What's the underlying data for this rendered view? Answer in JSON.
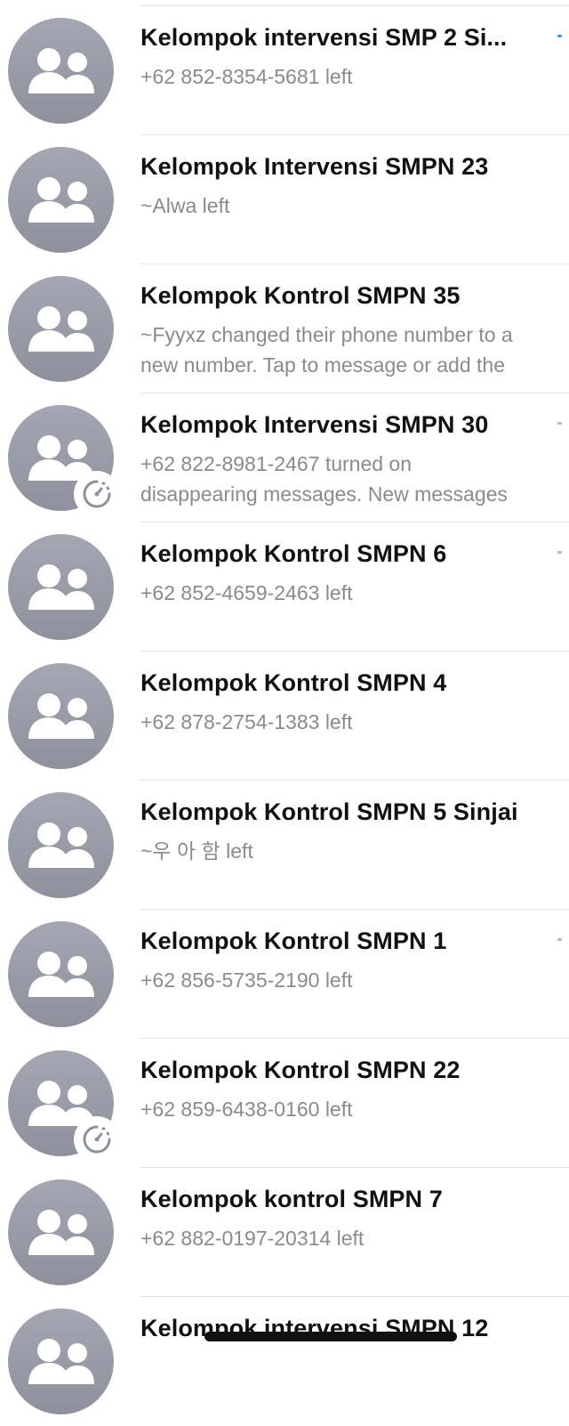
{
  "chats": [
    {
      "title": "Kelompok intervensi SMP 2 Si...",
      "subtitle": "+62 852-8354-5681 left",
      "avatar_icon": "group-icon",
      "disappearing": false,
      "unread_mark_color": "#4a8ff0"
    },
    {
      "title": "Kelompok Intervensi SMPN 23",
      "subtitle": "~Alwa left",
      "avatar_icon": "group-icon",
      "disappearing": false
    },
    {
      "title": "Kelompok Kontrol SMPN 35",
      "subtitle": "~Fyyxz changed their phone number to a\nnew number. Tap to message or add the",
      "avatar_icon": "group-icon",
      "disappearing": false
    },
    {
      "title": "Kelompok Intervensi SMPN 30",
      "subtitle": "+62 822-8981-2467 turned on\ndisappearing messages. New messages",
      "avatar_icon": "group-icon",
      "disappearing": true,
      "unread_mark_color": "#b9b9be"
    },
    {
      "title": "Kelompok Kontrol SMPN 6",
      "subtitle": "+62 852-4659-2463 left",
      "avatar_icon": "group-icon",
      "disappearing": false,
      "unread_mark_color": "#b9b9be"
    },
    {
      "title": "Kelompok Kontrol SMPN 4",
      "subtitle": "+62 878-2754-1383 left",
      "avatar_icon": "group-icon",
      "disappearing": false
    },
    {
      "title": "Kelompok Kontrol SMPN 5 Sinjai",
      "subtitle": "~우 아 함 left",
      "avatar_icon": "group-icon",
      "disappearing": false
    },
    {
      "title": "Kelompok Kontrol SMPN 1",
      "subtitle": "+62 856-5735-2190 left",
      "avatar_icon": "group-icon",
      "disappearing": false,
      "unread_mark_color": "#b9b9be"
    },
    {
      "title": "Kelompok Kontrol SMPN 22",
      "subtitle": "+62 859-6438-0160 left",
      "avatar_icon": "group-icon",
      "disappearing": true
    },
    {
      "title": "Kelompok kontrol SMPN 7",
      "subtitle": "+62 882-0197-20314 left",
      "avatar_icon": "group-icon",
      "disappearing": false
    },
    {
      "title": "Kelompok intervensi SMPN 12",
      "subtitle": "",
      "avatar_icon": "group-icon",
      "disappearing": false
    }
  ],
  "colors": {
    "avatar_background": "#9a9da7",
    "title_text": "#111111",
    "subtitle_text": "#8a8a8f",
    "divider": "#e3e3e6"
  }
}
